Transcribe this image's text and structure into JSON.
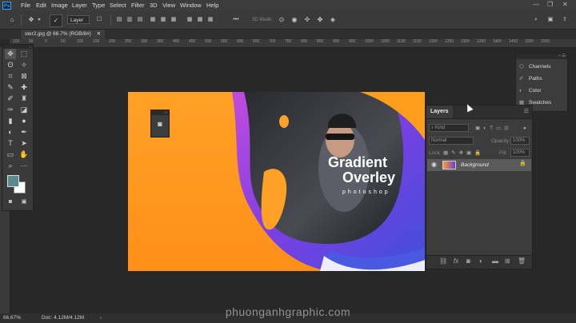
{
  "menubar": {
    "items": [
      "File",
      "Edit",
      "Image",
      "Layer",
      "Type",
      "Select",
      "Filter",
      "3D",
      "View",
      "Window",
      "Help"
    ],
    "logo": "Ps"
  },
  "optionsbar": {
    "layer_dropdown": "Layer",
    "mode_label": "3D Mode:"
  },
  "document_tab": {
    "label": "ster2.jpg @ 66.7% (RGB/8#)"
  },
  "ruler_ticks": [
    "100",
    "50",
    "0",
    "50",
    "100",
    "150",
    "200",
    "250",
    "300",
    "350",
    "400",
    "450",
    "500",
    "550",
    "600",
    "650",
    "700",
    "750",
    "800",
    "850",
    "900",
    "950",
    "1000",
    "1050",
    "1100",
    "1150",
    "1200",
    "1250",
    "1300",
    "1350",
    "1400",
    "1450",
    "1500",
    "1550"
  ],
  "canvas": {
    "headline_1": "Gradient",
    "headline_2": "Overley",
    "subtitle": "photoshop",
    "colors": {
      "orange": "#ff9d1c",
      "purple": "#7b3fe4",
      "blue": "#3f4fd8",
      "pink": "#c04bd8"
    }
  },
  "layers_panel": {
    "tab": "Layers",
    "kind_placeholder": "Kind",
    "blend_mode": "Normal",
    "opacity_label": "Opacity:",
    "opacity_value": "100%",
    "lock_label": "Lock:",
    "fill_label": "Fill:",
    "fill_value": "100%",
    "layer_name": "Background"
  },
  "right_panel": {
    "items": [
      "Channels",
      "Paths",
      "Color",
      "Swatches"
    ]
  },
  "status": {
    "zoom": "66.67%",
    "doc": "Doc: 4.12M/4.12M"
  },
  "watermark": "phuonganhgraphic.com"
}
